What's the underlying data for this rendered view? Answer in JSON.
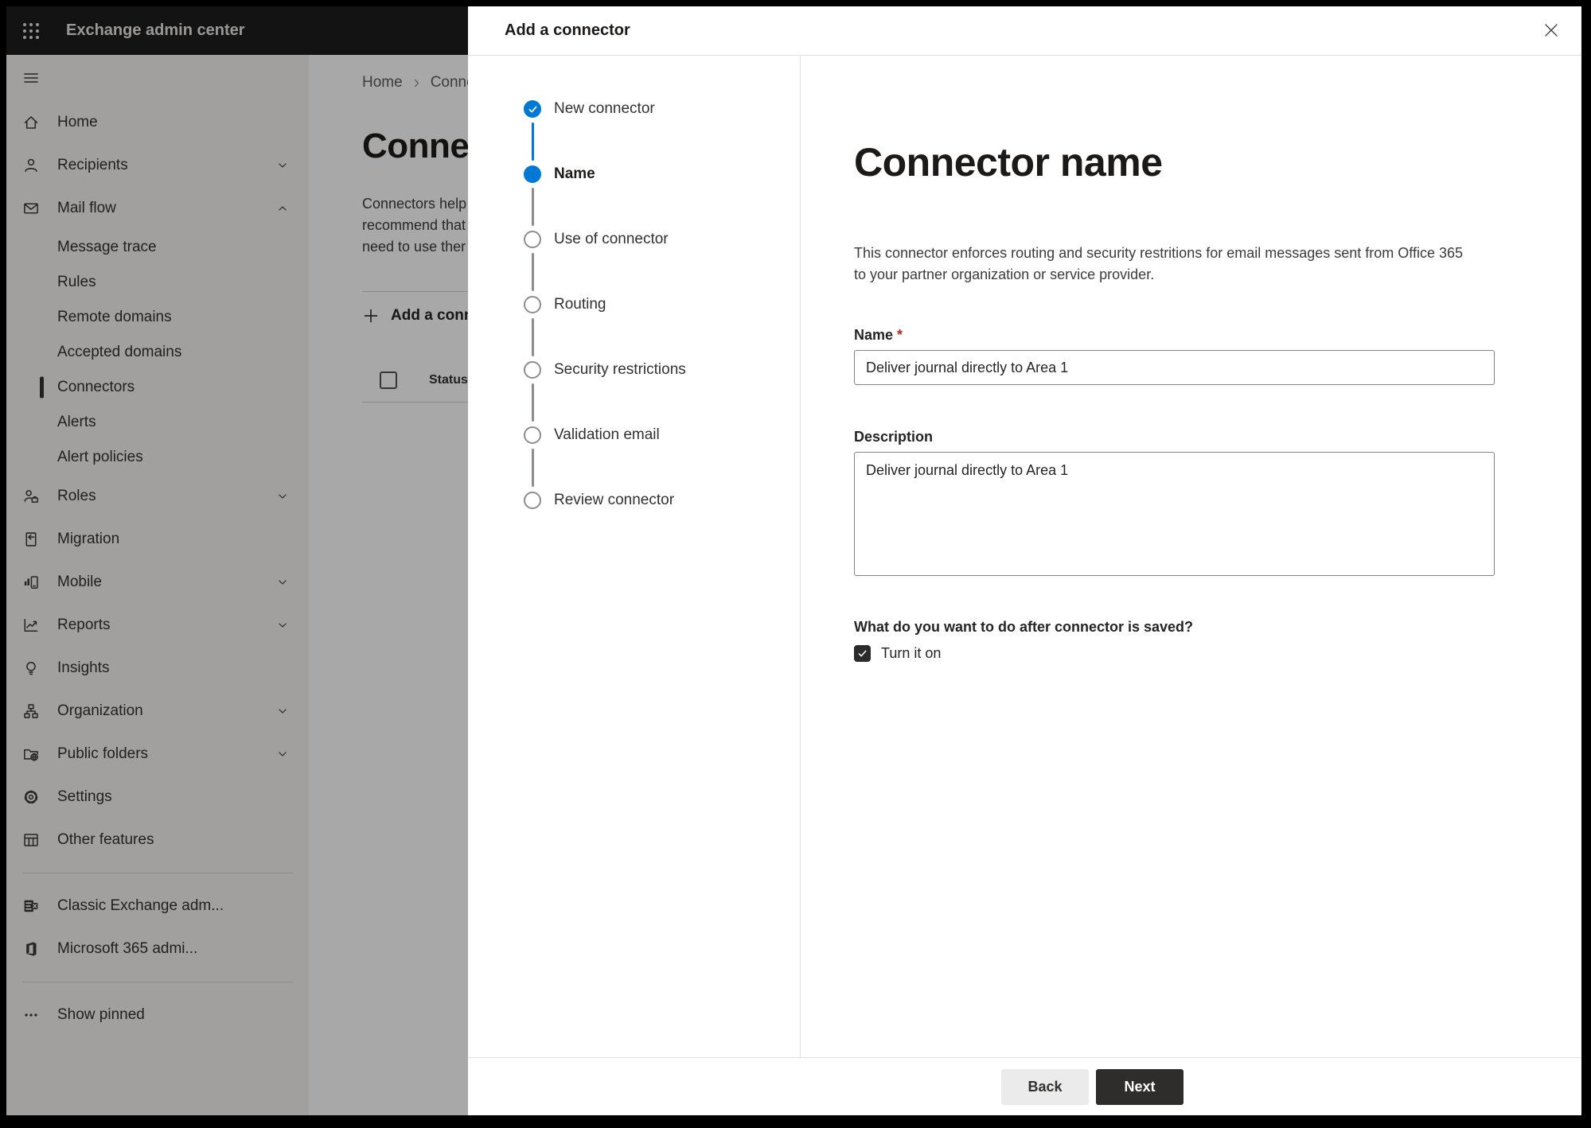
{
  "topbar": {
    "title": "Exchange admin center"
  },
  "sidebar": {
    "items": [
      {
        "label": "Home",
        "icon": "home-icon"
      },
      {
        "label": "Recipients",
        "icon": "person-icon",
        "chevron": "down"
      },
      {
        "label": "Mail flow",
        "icon": "mail-icon",
        "chevron": "up"
      },
      {
        "label": "Message trace",
        "sub": true
      },
      {
        "label": "Rules",
        "sub": true
      },
      {
        "label": "Remote domains",
        "sub": true
      },
      {
        "label": "Accepted domains",
        "sub": true
      },
      {
        "label": "Connectors",
        "sub": true,
        "selected": true
      },
      {
        "label": "Alerts",
        "sub": true
      },
      {
        "label": "Alert policies",
        "sub": true
      },
      {
        "label": "Roles",
        "icon": "roles-icon",
        "chevron": "down"
      },
      {
        "label": "Migration",
        "icon": "migration-icon"
      },
      {
        "label": "Mobile",
        "icon": "mobile-icon",
        "chevron": "down"
      },
      {
        "label": "Reports",
        "icon": "reports-icon",
        "chevron": "down"
      },
      {
        "label": "Insights",
        "icon": "insights-icon"
      },
      {
        "label": "Organization",
        "icon": "organization-icon",
        "chevron": "down"
      },
      {
        "label": "Public folders",
        "icon": "public-folders-icon",
        "chevron": "down"
      },
      {
        "label": "Settings",
        "icon": "settings-icon"
      },
      {
        "label": "Other features",
        "icon": "other-features-icon"
      },
      {
        "divider": true
      },
      {
        "label": "Classic Exchange adm...",
        "icon": "classic-exchange-icon"
      },
      {
        "label": "Microsoft 365 admi...",
        "icon": "microsoft-365-icon"
      },
      {
        "divider": true
      },
      {
        "label": "Show pinned",
        "icon": "more-icon"
      }
    ]
  },
  "page": {
    "breadcrumb": [
      "Home",
      "Conne"
    ],
    "title": "Connec",
    "intro_lines": [
      "Connectors help",
      "recommend that",
      "need to use ther"
    ],
    "add_button": "Add a conn",
    "status_column": "Status"
  },
  "dialog": {
    "title": "Add a connector",
    "steps": [
      {
        "label": "New connector",
        "state": "completed"
      },
      {
        "label": "Name",
        "state": "current"
      },
      {
        "label": "Use of connector",
        "state": "upcoming"
      },
      {
        "label": "Routing",
        "state": "upcoming"
      },
      {
        "label": "Security restrictions",
        "state": "upcoming"
      },
      {
        "label": "Validation email",
        "state": "upcoming"
      },
      {
        "label": "Review connector",
        "state": "upcoming"
      }
    ],
    "content": {
      "heading": "Connector name",
      "description_lines": [
        "This connector enforces routing and security restritions for email messages sent from Office 365",
        "to your partner organization or service provider."
      ],
      "name_label": "Name",
      "name_required": "*",
      "name_value": "Deliver journal directly to Area 1",
      "description_label": "Description",
      "description_value": "Deliver journal directly to Area 1",
      "after_save_question": "What do you want to do after connector is saved?",
      "turn_on_label": "Turn it on",
      "turn_on_checked": true
    },
    "footer": {
      "back": "Back",
      "next": "Next"
    }
  },
  "colors": {
    "accent_blue": "#0078d4",
    "required_red": "#b3271e",
    "primary_button_bg": "#2e2d2c",
    "topbar_bg": "#1f1e1d"
  }
}
